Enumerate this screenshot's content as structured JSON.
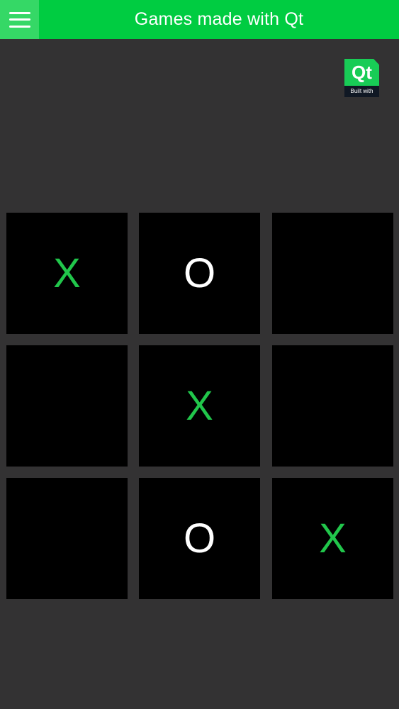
{
  "header": {
    "title": "Games made with Qt",
    "menu_icon": "hamburger-menu-icon"
  },
  "badge": {
    "logo_text": "Qt",
    "caption": "Built with"
  },
  "board": {
    "cells": [
      "X",
      "O",
      "",
      "",
      "X",
      "",
      "",
      "O",
      "X"
    ]
  },
  "colors": {
    "header_bg": "#00cc41",
    "menu_bg": "#35d866",
    "page_bg": "#333233",
    "cell_bg": "#000000",
    "x_color": "#21c64b",
    "o_color": "#ffffff"
  }
}
